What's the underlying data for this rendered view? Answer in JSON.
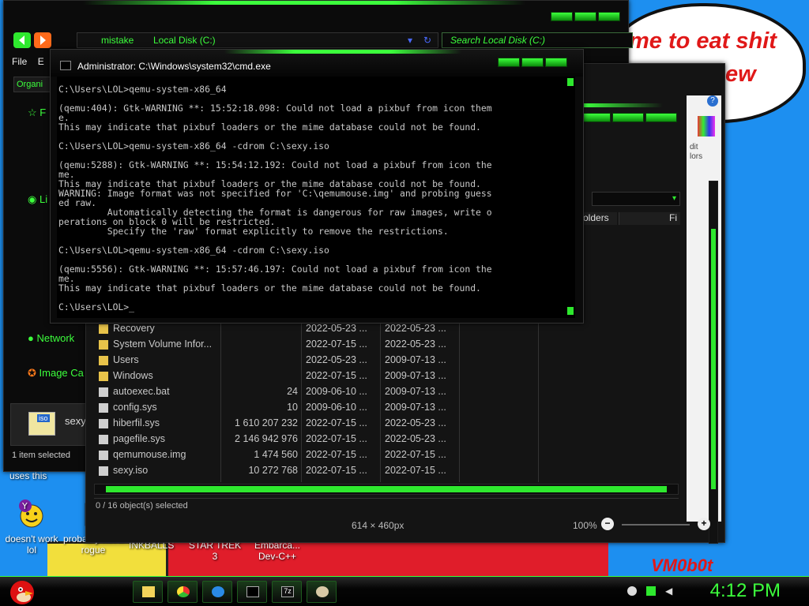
{
  "wallpaper": {
    "bubble_line1": "me to eat shit",
    "bubble_line2": "ew",
    "signature": "VM0b0t"
  },
  "desktop_icons": [
    {
      "label": "doesn't work lol"
    },
    {
      "label": "probably not a rogue"
    },
    {
      "label": "INKBALLS"
    },
    {
      "label": "STAR TREK 3"
    },
    {
      "label": "Embarca... Dev-C++"
    }
  ],
  "desktop_misc": {
    "uses_this": "uses this"
  },
  "explorer_back": {
    "breadcrumb_user": "mistake",
    "breadcrumb_disk": "Local Disk (C:)",
    "search_placeholder": "Search Local Disk (C:)",
    "menu": [
      "File",
      "E"
    ],
    "organize": "Organi",
    "sidebar": [
      {
        "label": "F"
      },
      {
        "label": "Li"
      },
      {
        "label": "Network"
      },
      {
        "label": "Image Ca"
      }
    ],
    "preview_name": "sexy.",
    "preview_label": "iso",
    "status": "1 item selected"
  },
  "explorer_front": {
    "columns": [
      "olders",
      "Fi"
    ],
    "right_panel": [
      "dit",
      "lors"
    ],
    "files": [
      {
        "name": "Recovery",
        "size": "",
        "modified": "2022-05-23 ...",
        "created": "2022-05-23 ..."
      },
      {
        "name": "System Volume Infor...",
        "size": "",
        "modified": "2022-07-15 ...",
        "created": "2022-05-23 ..."
      },
      {
        "name": "Users",
        "size": "",
        "modified": "2022-05-23 ...",
        "created": "2009-07-13 ..."
      },
      {
        "name": "Windows",
        "size": "",
        "modified": "2022-07-15 ...",
        "created": "2009-07-13 ..."
      },
      {
        "name": "autoexec.bat",
        "size": "24",
        "modified": "2009-06-10 ...",
        "created": "2009-07-13 ..."
      },
      {
        "name": "config.sys",
        "size": "10",
        "modified": "2009-06-10 ...",
        "created": "2009-07-13 ..."
      },
      {
        "name": "hiberfil.sys",
        "size": "1 610 207 232",
        "modified": "2022-07-15 ...",
        "created": "2022-05-23 ..."
      },
      {
        "name": "pagefile.sys",
        "size": "2 146 942 976",
        "modified": "2022-07-15 ...",
        "created": "2022-05-23 ..."
      },
      {
        "name": "qemumouse.img",
        "size": "1 474 560",
        "modified": "2022-07-15 ...",
        "created": "2022-07-15 ..."
      },
      {
        "name": "sexy.iso",
        "size": "10 272 768",
        "modified": "2022-07-15 ...",
        "created": "2022-07-15 ..."
      }
    ],
    "status": "0 / 16 object(s) selected",
    "image_size": "614 × 460px",
    "zoom": "100%"
  },
  "cmd": {
    "title": "Administrator: C:\\Windows\\system32\\cmd.exe",
    "output": "C:\\Users\\LOL>qemu-system-x86_64\n\n(qemu:404): Gtk-WARNING **: 15:52:18.098: Could not load a pixbuf from icon them\ne.\nThis may indicate that pixbuf loaders or the mime database could not be found.\n\nC:\\Users\\LOL>qemu-system-x86_64 -cdrom C:\\sexy.iso\n\n(qemu:5288): Gtk-WARNING **: 15:54:12.192: Could not load a pixbuf from icon the\nme.\nThis may indicate that pixbuf loaders or the mime database could not be found.\nWARNING: Image format was not specified for 'C:\\qemumouse.img' and probing guess\ned raw.\n         Automatically detecting the format is dangerous for raw images, write o\nperations on block 0 will be restricted.\n         Specify the 'raw' format explicitly to remove the restrictions.\n\nC:\\Users\\LOL>qemu-system-x86_64 -cdrom C:\\sexy.iso\n\n(qemu:5556): Gtk-WARNING **: 15:57:46.197: Could not load a pixbuf from icon the\nme.\nThis may indicate that pixbuf loaders or the mime database could not be found.\n\nC:\\Users\\LOL>_"
  },
  "taskbar": {
    "clock": "4:12 PM",
    "apps": [
      "explorer",
      "chrome",
      "ie",
      "cmd",
      "7zip",
      "paint"
    ]
  },
  "colors": {
    "accent": "#3cff3c",
    "desktop": "#1d8ff0"
  }
}
